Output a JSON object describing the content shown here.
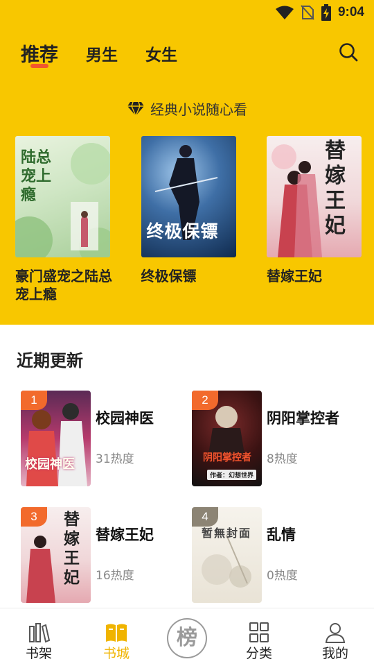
{
  "status": {
    "time": "9:04"
  },
  "tabs": [
    {
      "label": "推荐",
      "active": true
    },
    {
      "label": "男生",
      "active": false
    },
    {
      "label": "女生",
      "active": false
    }
  ],
  "slogan": "经典小说随心看",
  "featured": [
    {
      "title": "豪门盛宠之陆总宠上瘾",
      "cover_text": "陆总宠上瘾"
    },
    {
      "title": "终极保镖",
      "cover_text": "终极保镖"
    },
    {
      "title": "替嫁王妃",
      "cover_text": "替嫁王妃"
    }
  ],
  "recent": {
    "title": "近期更新",
    "items": [
      {
        "rank": "1",
        "name": "校园神医",
        "heat": "31热度",
        "cover_text": "校园神医"
      },
      {
        "rank": "2",
        "name": "阴阳掌控者",
        "heat": "8热度",
        "cover_text": "阴阳掌控者",
        "cover_sub": "作者：幻想世界"
      },
      {
        "rank": "3",
        "name": "替嫁王妃",
        "heat": "16热度",
        "cover_text": "替嫁王妃"
      },
      {
        "rank": "4",
        "name": "乱情",
        "heat": "0热度",
        "cover_text": "暂無封面"
      }
    ]
  },
  "nav": {
    "items": [
      {
        "label": "书架",
        "icon": "bookshelf-icon"
      },
      {
        "label": "书城",
        "icon": "open-book-icon",
        "active": true
      },
      {
        "label": "榜",
        "icon": "ranking-icon"
      },
      {
        "label": "分类",
        "icon": "grid-icon"
      },
      {
        "label": "我的",
        "icon": "person-icon"
      }
    ]
  },
  "colors": {
    "header_bg": "#f8c700",
    "accent": "#f2572d",
    "rank_badge": "#f26a2c",
    "nav_active": "#f0b400"
  }
}
